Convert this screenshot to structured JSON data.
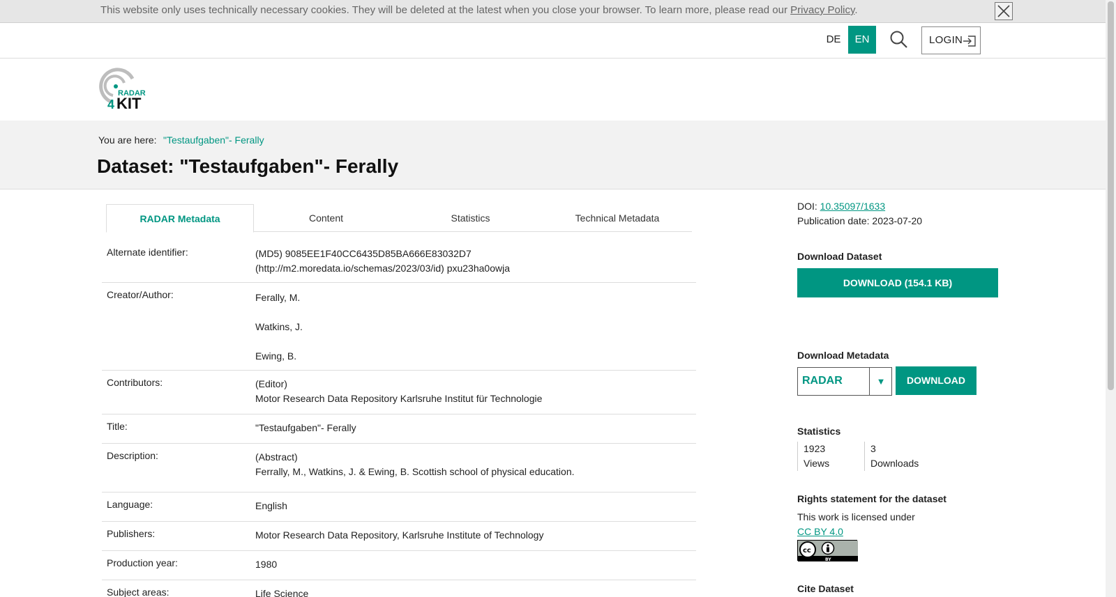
{
  "cookie": {
    "text": "This website only uses technically necessary cookies. They will be deleted at the latest when you close your browser. To learn more, please read our ",
    "link": "Privacy Policy",
    "end": "."
  },
  "nav": {
    "lang_de": "DE",
    "lang_en": "EN",
    "login": "LOGIN"
  },
  "logo": {
    "line1": "RADAR",
    "prefix": "4",
    "word": "KIT"
  },
  "breadcrumb": {
    "label": "You are here:",
    "item": "\"Testaufgaben\"- Ferally"
  },
  "page_title": "Dataset: \"Testaufgaben\"- Ferally",
  "tabs": [
    "RADAR Metadata",
    "Content",
    "Statistics",
    "Technical Metadata"
  ],
  "metadata": {
    "alt_id": {
      "label": "Alternate identifier:",
      "v1": "(MD5) 9085EE1F40CC6435D85BA666E83032D7",
      "v2": "(http://m2.moredata.io/schemas/2023/03/id) pxu23ha0owja"
    },
    "creator": {
      "label": "Creator/Author:",
      "v1": "Ferally, M.",
      "v2": "Watkins, J.",
      "v3": "Ewing, B."
    },
    "contributors": {
      "label": "Contributors:",
      "v1": "(Editor)",
      "v2": "Motor Research Data Repository Karlsruhe Institut für Technologie"
    },
    "title": {
      "label": "Title:",
      "v1": "\"Testaufgaben\"- Ferally"
    },
    "description": {
      "label": "Description:",
      "v1": "(Abstract)",
      "v2": "Ferrally, M., Watkins, J. & Ewing, B. Scottish school of physical education."
    },
    "language": {
      "label": "Language:",
      "v1": "English"
    },
    "publishers": {
      "label": "Publishers:",
      "v1": "Motor Research Data Repository, Karlsruhe Institute of Technology"
    },
    "production_year": {
      "label": "Production year:",
      "v1": "1980"
    },
    "subject_areas": {
      "label": "Subject areas:",
      "v1": "Life Science"
    }
  },
  "sidebar": {
    "doi_label": "DOI:",
    "doi": "10.35097/1633",
    "pub_date": "Publication date: 2023-07-20",
    "download_dataset_heading": "Download Dataset",
    "download_dataset_button": "DOWNLOAD (154.1 KB)",
    "download_metadata_heading": "Download Metadata",
    "metadata_format": "RADAR",
    "metadata_download_button": "DOWNLOAD",
    "statistics_heading": "Statistics",
    "views_count": "1923",
    "views_label": "Views",
    "downloads_count": "3",
    "downloads_label": "Downloads",
    "rights_heading": "Rights statement for the dataset",
    "rights_text": "This work is licensed under",
    "license_link": "CC BY 4.0",
    "license_badge_text": "BY",
    "cite_heading": "Cite Dataset"
  },
  "colors": {
    "accent": "#009682",
    "band": "#f2f2f2"
  },
  "icons": [
    "close-icon",
    "search-icon",
    "login-icon",
    "chevron-down-icon",
    "cc-by-icon"
  ]
}
